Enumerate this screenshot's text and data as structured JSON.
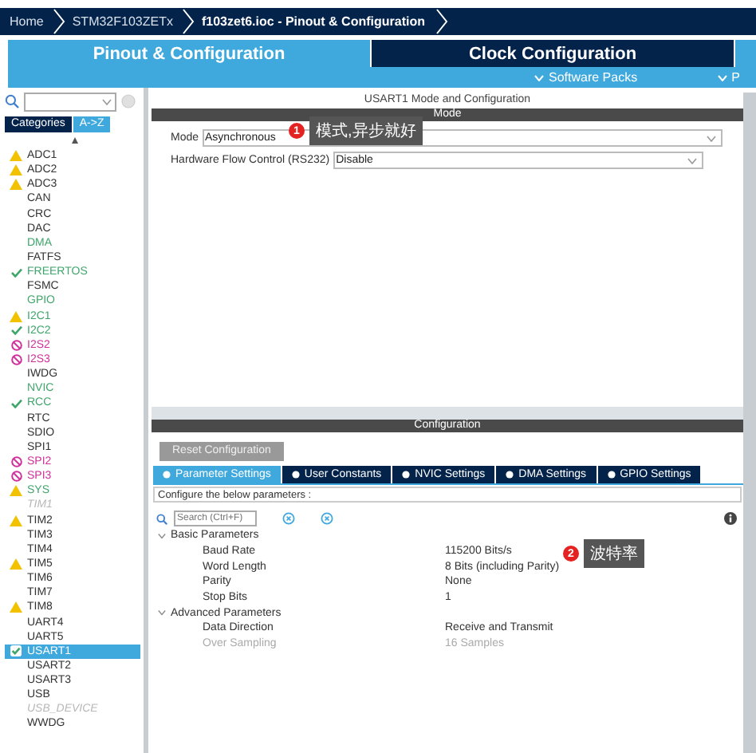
{
  "breadcrumb": [
    "Home",
    "STM32F103ZETx",
    "f103zet6.ioc - Pinout & Configuration"
  ],
  "tabs": [
    {
      "label": "Pinout & Configuration",
      "selected": true
    },
    {
      "label": "Clock Configuration",
      "selected": false
    }
  ],
  "subtabs": [
    "Software Packs",
    "P"
  ],
  "sidebar": {
    "view_tabs": [
      {
        "label": "Categories",
        "selected": false
      },
      {
        "label": "A->Z",
        "selected": true
      }
    ],
    "items": [
      {
        "label": "ADC1",
        "kind": "warning",
        "color": "#333333",
        "selected": false,
        "disabled": false
      },
      {
        "label": "ADC2",
        "kind": "warning",
        "color": "#333333",
        "selected": false,
        "disabled": false
      },
      {
        "label": "ADC3",
        "kind": "warning",
        "color": "#333333",
        "selected": false,
        "disabled": false
      },
      {
        "label": "CAN",
        "kind": "plain",
        "color": "#333333",
        "selected": false,
        "disabled": false
      },
      {
        "label": "CRC",
        "kind": "plain",
        "color": "#333333",
        "selected": false,
        "disabled": false
      },
      {
        "label": "DAC",
        "kind": "plain",
        "color": "#333333",
        "selected": false,
        "disabled": false
      },
      {
        "label": "DMA",
        "kind": "plain",
        "color": "#3fa66b",
        "selected": false,
        "disabled": false
      },
      {
        "label": "FATFS",
        "kind": "plain",
        "color": "#333333",
        "selected": false,
        "disabled": false
      },
      {
        "label": "FREERTOS",
        "kind": "check",
        "color": "#3fa66b",
        "selected": false,
        "disabled": false
      },
      {
        "label": "FSMC",
        "kind": "plain",
        "color": "#333333",
        "selected": false,
        "disabled": false
      },
      {
        "label": "GPIO",
        "kind": "plain",
        "color": "#3fa66b",
        "selected": false,
        "disabled": false
      },
      {
        "label": "I2C1",
        "kind": "warning",
        "color": "#3fa66b",
        "selected": false,
        "disabled": false
      },
      {
        "label": "I2C2",
        "kind": "check",
        "color": "#3fa66b",
        "selected": false,
        "disabled": false
      },
      {
        "label": "I2S2",
        "kind": "blocked",
        "color": "#d0309a",
        "selected": false,
        "disabled": false
      },
      {
        "label": "I2S3",
        "kind": "blocked",
        "color": "#d0309a",
        "selected": false,
        "disabled": false
      },
      {
        "label": "IWDG",
        "kind": "plain",
        "color": "#333333",
        "selected": false,
        "disabled": false
      },
      {
        "label": "NVIC",
        "kind": "plain",
        "color": "#3fa66b",
        "selected": false,
        "disabled": false
      },
      {
        "label": "RCC",
        "kind": "check",
        "color": "#3fa66b",
        "selected": false,
        "disabled": false
      },
      {
        "label": "RTC",
        "kind": "plain",
        "color": "#333333",
        "selected": false,
        "disabled": false
      },
      {
        "label": "SDIO",
        "kind": "plain",
        "color": "#333333",
        "selected": false,
        "disabled": false
      },
      {
        "label": "SPI1",
        "kind": "plain",
        "color": "#333333",
        "selected": false,
        "disabled": false
      },
      {
        "label": "SPI2",
        "kind": "blocked",
        "color": "#d0309a",
        "selected": false,
        "disabled": false
      },
      {
        "label": "SPI3",
        "kind": "blocked",
        "color": "#d0309a",
        "selected": false,
        "disabled": false
      },
      {
        "label": "SYS",
        "kind": "warning",
        "color": "#3fa66b",
        "selected": false,
        "disabled": false
      },
      {
        "label": "TIM1",
        "kind": "plain",
        "color": "#b8b8b8",
        "selected": false,
        "disabled": true
      },
      {
        "label": "TIM2",
        "kind": "warning",
        "color": "#333333",
        "selected": false,
        "disabled": false
      },
      {
        "label": "TIM3",
        "kind": "plain",
        "color": "#333333",
        "selected": false,
        "disabled": false
      },
      {
        "label": "TIM4",
        "kind": "plain",
        "color": "#333333",
        "selected": false,
        "disabled": false
      },
      {
        "label": "TIM5",
        "kind": "warning",
        "color": "#333333",
        "selected": false,
        "disabled": false
      },
      {
        "label": "TIM6",
        "kind": "plain",
        "color": "#333333",
        "selected": false,
        "disabled": false
      },
      {
        "label": "TIM7",
        "kind": "plain",
        "color": "#333333",
        "selected": false,
        "disabled": false
      },
      {
        "label": "TIM8",
        "kind": "warning",
        "color": "#333333",
        "selected": false,
        "disabled": false
      },
      {
        "label": "UART4",
        "kind": "plain",
        "color": "#333333",
        "selected": false,
        "disabled": false
      },
      {
        "label": "UART5",
        "kind": "plain",
        "color": "#333333",
        "selected": false,
        "disabled": false
      },
      {
        "label": "USART1",
        "kind": "checkbox",
        "selected": true,
        "disabled": false
      },
      {
        "label": "USART2",
        "kind": "plain",
        "color": "#333333",
        "selected": false,
        "disabled": false
      },
      {
        "label": "USART3",
        "kind": "plain",
        "color": "#333333",
        "selected": false,
        "disabled": false
      },
      {
        "label": "USB",
        "kind": "plain",
        "color": "#333333",
        "selected": false,
        "disabled": false
      },
      {
        "label": "USB_DEVICE",
        "kind": "plain",
        "color": "#b8b8b8",
        "selected": false,
        "disabled": true
      },
      {
        "label": "WWDG",
        "kind": "plain",
        "color": "#333333",
        "selected": false,
        "disabled": false
      }
    ]
  },
  "panel": {
    "title": "USART1 Mode and Configuration",
    "mode_header": "Mode",
    "mode_fields": [
      {
        "label": "Mode",
        "value": "Asynchronous"
      },
      {
        "label": "Hardware Flow Control (RS232)",
        "value": "Disable"
      }
    ],
    "callouts": [
      {
        "number": "1",
        "text": "模式,异步就好"
      },
      {
        "number": "2",
        "text": "波特率"
      }
    ],
    "config_header": "Configuration",
    "reset_button": "Reset Configuration",
    "config_tabs": [
      {
        "label": "Parameter Settings",
        "selected": true
      },
      {
        "label": "User Constants",
        "selected": false
      },
      {
        "label": "NVIC Settings",
        "selected": false
      },
      {
        "label": "DMA Settings",
        "selected": false
      },
      {
        "label": "GPIO Settings",
        "selected": false
      }
    ],
    "hint": "Configure the below parameters :",
    "search": {
      "placeholder": "Search (Ctrl+F)"
    },
    "groups": [
      {
        "label": "Basic Parameters",
        "expanded": true,
        "params": [
          {
            "name": "Baud Rate",
            "value": "115200 Bits/s",
            "disabled": false
          },
          {
            "name": "Word Length",
            "value": "8 Bits (including Parity)",
            "disabled": false
          },
          {
            "name": "Parity",
            "value": "None",
            "disabled": false
          },
          {
            "name": "Stop Bits",
            "value": "1",
            "disabled": false
          }
        ]
      },
      {
        "label": "Advanced Parameters",
        "expanded": true,
        "params": [
          {
            "name": "Data Direction",
            "value": "Receive and Transmit",
            "disabled": false
          },
          {
            "name": "Over Sampling",
            "value": "16 Samples",
            "disabled": true
          }
        ]
      }
    ]
  }
}
